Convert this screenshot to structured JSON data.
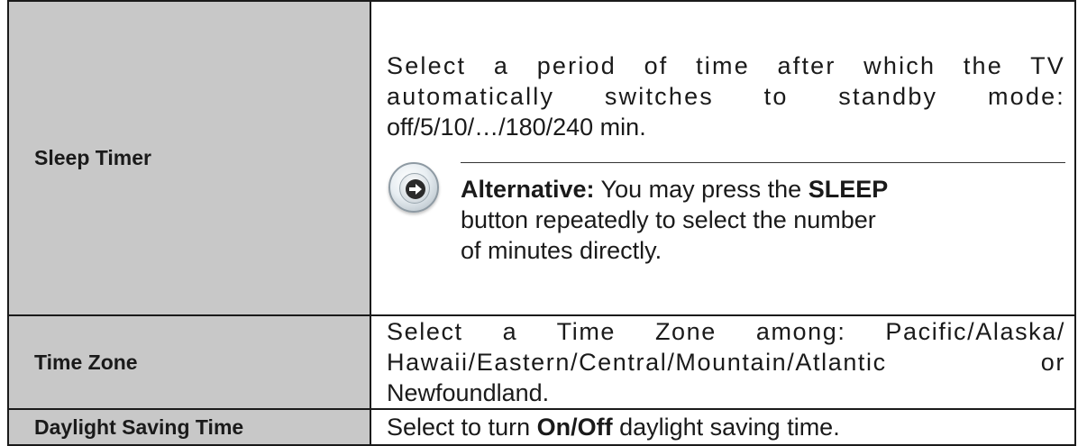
{
  "rows": [
    {
      "label": "Sleep Timer",
      "desc_lines": [
        "Select a period of time after which the TV",
        "automatically switches to standby mode:",
        "off/5/10/…/180/240 min."
      ],
      "note": {
        "icon": "arrow-right-circle-icon",
        "prefix_bold": "Alternative:",
        "text_1": " You may press the ",
        "key_bold": "SLEEP",
        "line_2": "button repeatedly to select the number",
        "line_3": "of minutes directly."
      }
    },
    {
      "label": "Time Zone",
      "desc_lines": [
        "Select a Time Zone among: Pacific/Alaska/",
        "Hawaii/Eastern/Central/Mountain/Atlantic or",
        "Newfoundland."
      ]
    },
    {
      "label": "Daylight Saving Time",
      "desc_prefix": "Select to turn ",
      "desc_bold": "On/Off",
      "desc_suffix": " daylight saving time."
    }
  ]
}
